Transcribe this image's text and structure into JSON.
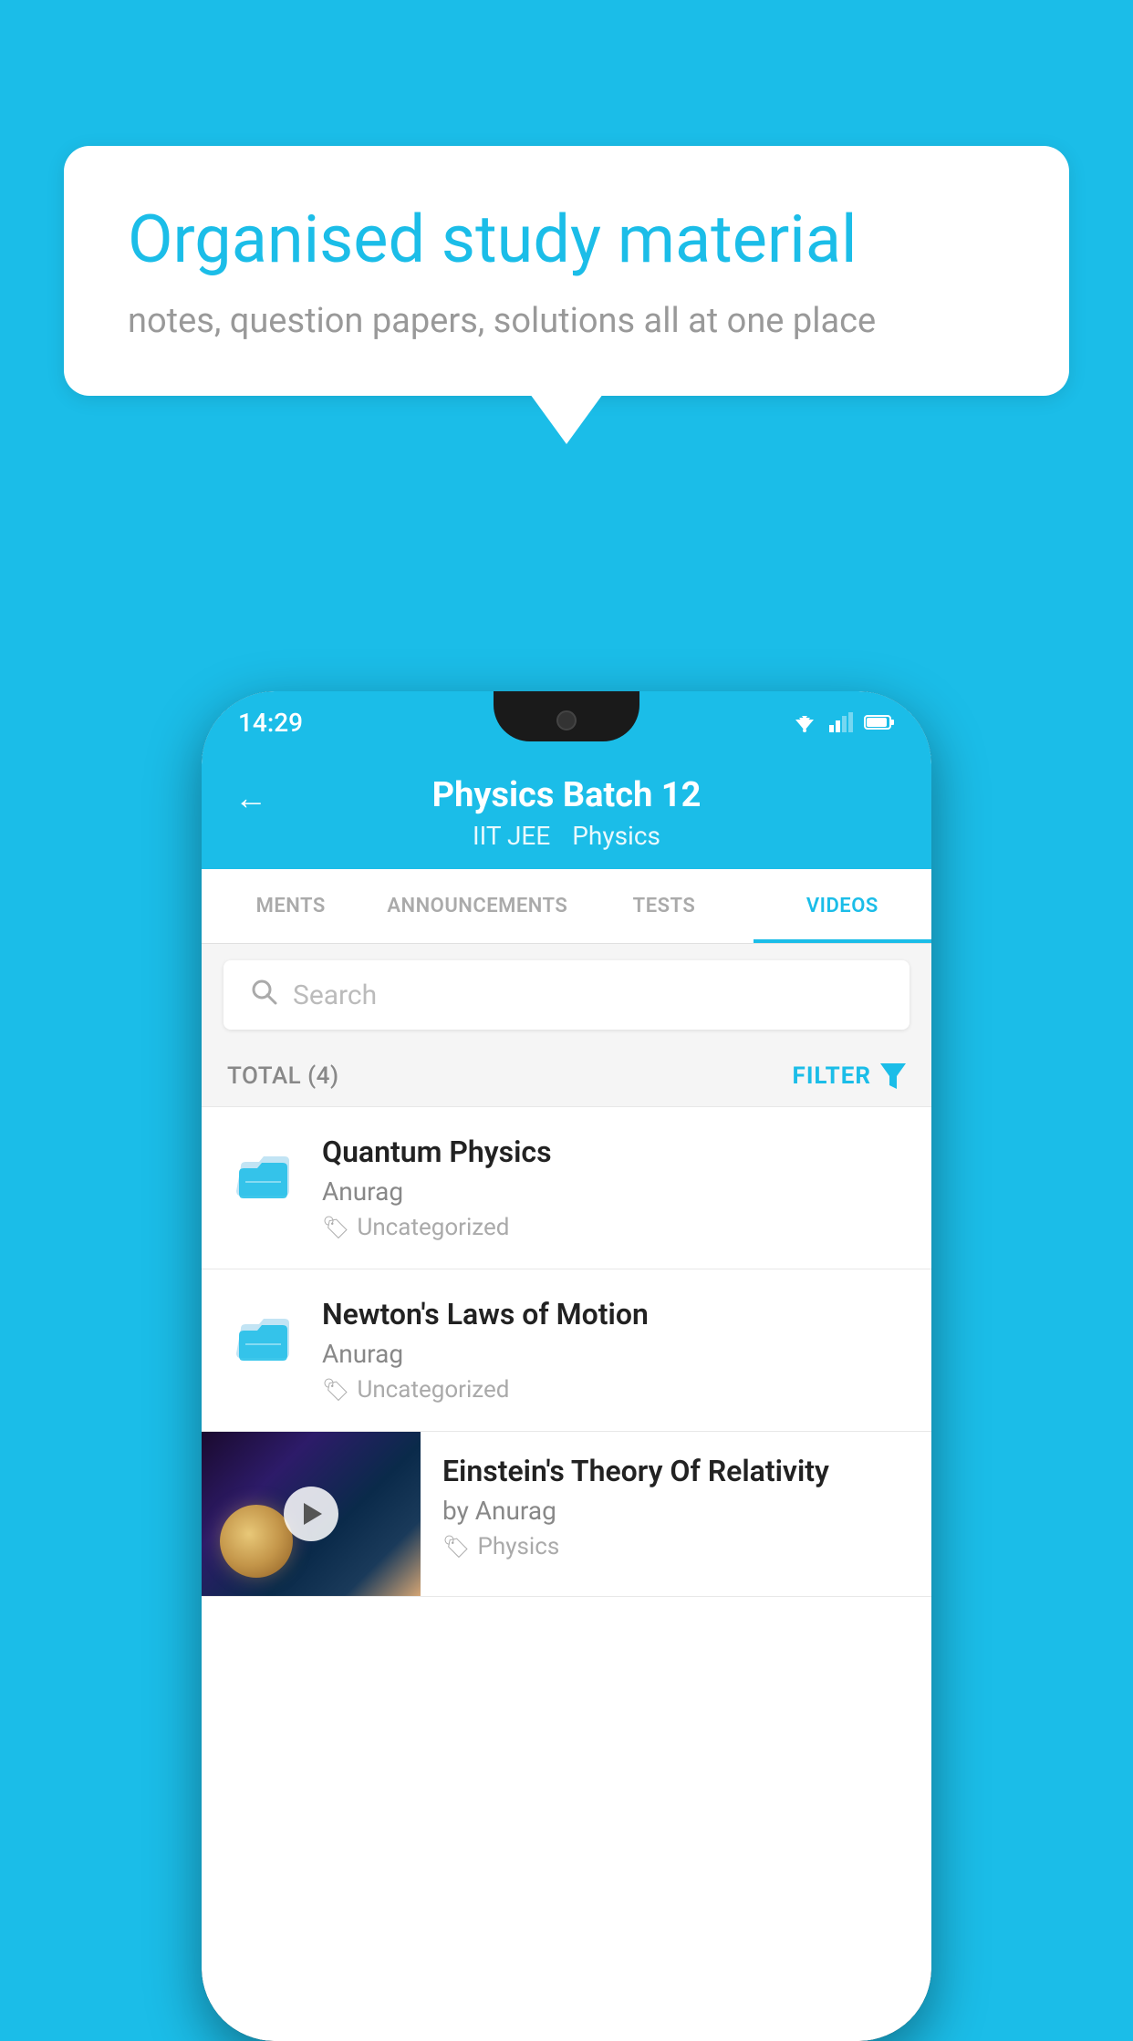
{
  "background_color": "#1BBDE8",
  "bubble": {
    "title": "Organised study material",
    "subtitle": "notes, question papers, solutions all at one place"
  },
  "phone": {
    "status_bar": {
      "time": "14:29"
    },
    "header": {
      "back_arrow": "←",
      "title": "Physics Batch 12",
      "tag1": "IIT JEE",
      "tag2": "Physics"
    },
    "tabs": [
      {
        "label": "MENTS",
        "active": false
      },
      {
        "label": "ANNOUNCEMENTS",
        "active": false
      },
      {
        "label": "TESTS",
        "active": false
      },
      {
        "label": "VIDEOS",
        "active": true
      }
    ],
    "search": {
      "placeholder": "Search"
    },
    "filter": {
      "total_label": "TOTAL (4)",
      "filter_label": "FILTER"
    },
    "videos": [
      {
        "id": 1,
        "title": "Quantum Physics",
        "author": "Anurag",
        "tag": "Uncategorized",
        "type": "folder"
      },
      {
        "id": 2,
        "title": "Newton's Laws of Motion",
        "author": "Anurag",
        "tag": "Uncategorized",
        "type": "folder"
      },
      {
        "id": 3,
        "title": "Einstein's Theory Of Relativity",
        "author": "by Anurag",
        "tag": "Physics",
        "type": "video"
      }
    ]
  }
}
